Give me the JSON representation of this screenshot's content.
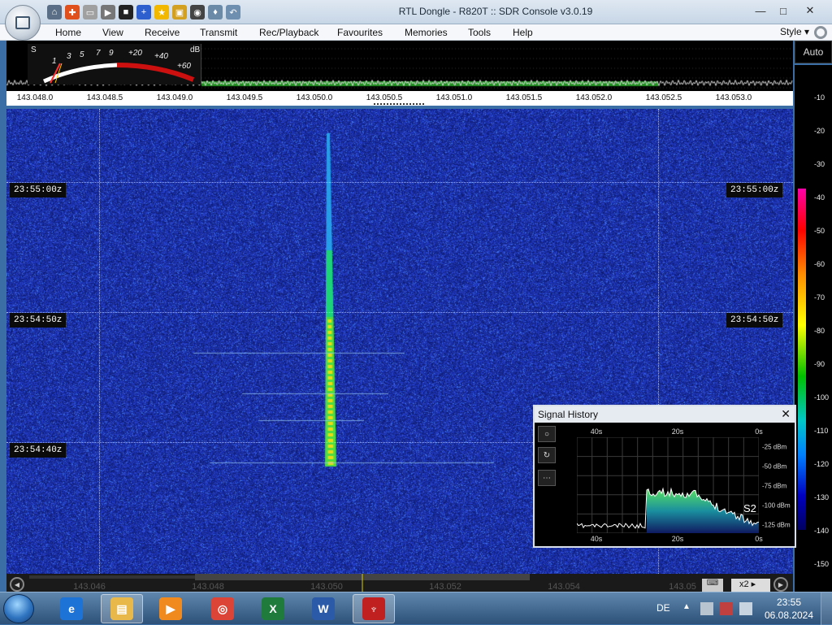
{
  "window": {
    "title": "RTL Dongle - R820T :: SDR Console v3.0.19",
    "controls": {
      "minimize": "—",
      "maximize": "□",
      "close": "✕"
    }
  },
  "quick_access": [
    {
      "icon": "home-icon",
      "color": "#5a6f85",
      "glyph": "⌂"
    },
    {
      "icon": "lifebuoy-icon",
      "color": "#e0501c",
      "glyph": "✚"
    },
    {
      "icon": "folder-icon",
      "color": "#a0a0a0",
      "glyph": "▭"
    },
    {
      "icon": "play-icon",
      "color": "#777777",
      "glyph": "▶"
    },
    {
      "icon": "stop-icon",
      "color": "#222222",
      "glyph": "■"
    },
    {
      "icon": "plus-icon",
      "color": "#2d5fcf",
      "glyph": "+"
    },
    {
      "icon": "star-icon",
      "color": "#f2b800",
      "glyph": "★"
    },
    {
      "icon": "lock-icon",
      "color": "#d4a020",
      "glyph": "▣"
    },
    {
      "icon": "camera-icon",
      "color": "#444444",
      "glyph": "◉"
    },
    {
      "icon": "droplet-icon",
      "color": "#6a8aa8",
      "glyph": "♦"
    },
    {
      "icon": "undo-icon",
      "color": "#6f8fb0",
      "glyph": "↶"
    }
  ],
  "menu": {
    "items": [
      "Home",
      "View",
      "Receive",
      "Transmit",
      "Rec/Playback",
      "Favourites",
      "Memories",
      "Tools",
      "Help"
    ],
    "style": "Style ▾"
  },
  "meter": {
    "s_label": "S",
    "db_label": "dB",
    "s_ticks": [
      "1",
      "3",
      "5",
      "7",
      "9"
    ],
    "plus_ticks": [
      "+20",
      "+40",
      "+60"
    ]
  },
  "auto_button": "Auto",
  "frequency_axis": {
    "labels": [
      "143.048.0",
      "143.048.5",
      "143.049.0",
      "143.049.5",
      "143.050.0",
      "143.050.5",
      "143.051.0",
      "143.051.5",
      "143.052.0",
      "143.052.5",
      "143.053.0"
    ]
  },
  "waterfall": {
    "time_labels": [
      "23:55:00z",
      "23:54:50z",
      "23:54:40z"
    ],
    "colors": {
      "background": "#0f1e7a",
      "signal_core": "#ffe000",
      "signal_mid": "#20d060"
    }
  },
  "db_scale": {
    "labels": [
      "-10",
      "-20",
      "-30",
      "-40",
      "-50",
      "-60",
      "-70",
      "-80",
      "-90",
      "-100",
      "-110",
      "-120",
      "-130",
      "-140",
      "-150"
    ]
  },
  "bottom_scale": {
    "labels": [
      "143.046",
      "143.048",
      "143.050",
      "143.052",
      "143.054",
      "143.05"
    ],
    "zoom": "x2 ▸"
  },
  "signal_history": {
    "title": "Signal History",
    "close": "✕",
    "tools": [
      "○",
      "↻",
      "⋯"
    ],
    "time_labels": [
      "40s",
      "20s",
      "0s"
    ],
    "db_labels": [
      "-25 dBm",
      "-50 dBm",
      "-75 dBm",
      "-100 dBm",
      "-125 dBm"
    ],
    "s_meter": "S2"
  },
  "taskbar": {
    "apps": [
      {
        "name": "internet-explorer",
        "color": "#1e73d6",
        "glyph": "e",
        "active": false
      },
      {
        "name": "file-explorer",
        "color": "#e8b84a",
        "glyph": "▤",
        "active": true
      },
      {
        "name": "media-player",
        "color": "#f08a1e",
        "glyph": "▶",
        "active": false
      },
      {
        "name": "chrome",
        "color": "#db4437",
        "glyph": "◎",
        "active": false
      },
      {
        "name": "excel",
        "color": "#1e7b3c",
        "glyph": "X",
        "active": false
      },
      {
        "name": "word",
        "color": "#2a5aa8",
        "glyph": "W",
        "active": false
      },
      {
        "name": "sdr-console",
        "color": "#c02020",
        "glyph": "♆",
        "active": true
      }
    ],
    "language": "DE",
    "tray_arrow": "▲",
    "clock_time": "23:55",
    "clock_date": "06.08.2024"
  }
}
